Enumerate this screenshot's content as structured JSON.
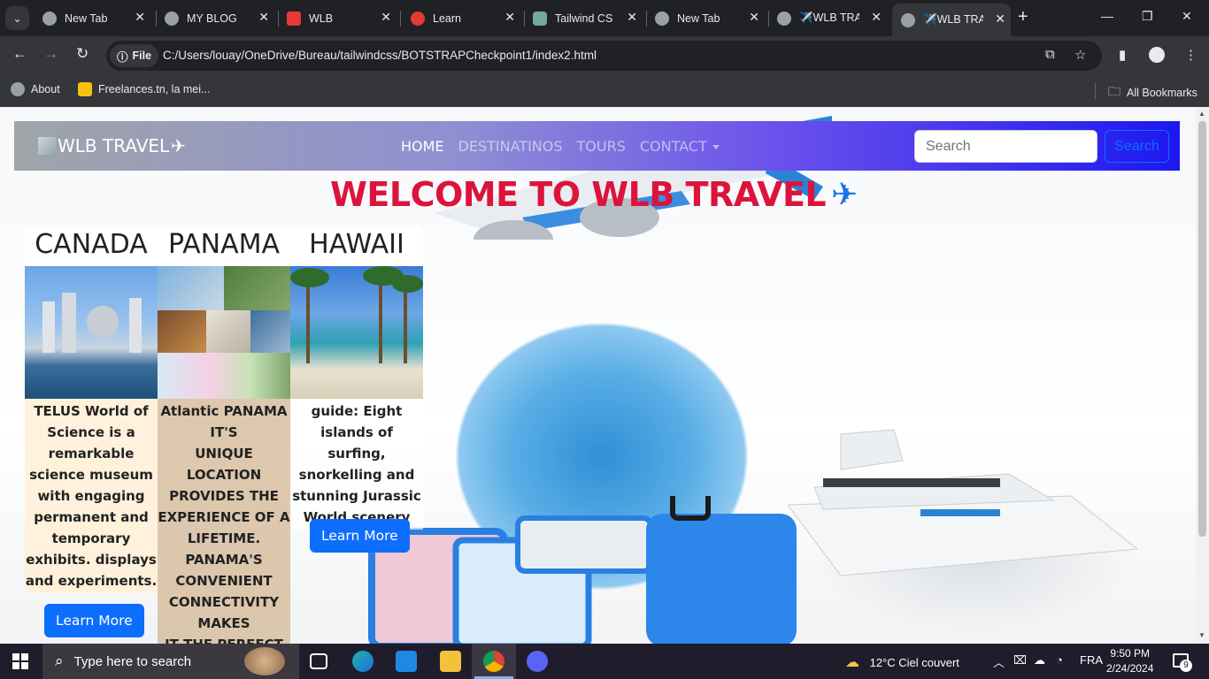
{
  "browser": {
    "tabs": [
      {
        "title": "New Tab",
        "favicon": "chrome-icon"
      },
      {
        "title": "MY BLOG",
        "favicon": "globe-icon"
      },
      {
        "title": "WLB",
        "favicon": "red-d-icon"
      },
      {
        "title": "Learn",
        "favicon": "red-circle-icon"
      },
      {
        "title": "Tailwind CSS",
        "favicon": "chatgpt-icon"
      },
      {
        "title": "New Tab",
        "favicon": "chrome-icon"
      },
      {
        "title": "✈️WLB TRAVEL",
        "favicon": "globe-icon"
      },
      {
        "title": "✈️WLB TRAVEL",
        "favicon": "globe-icon",
        "active": true
      }
    ],
    "address": {
      "scheme_label": "File",
      "url": "C:/Users/louay/OneDrive/Bureau/tailwindcss/BOTSTRAPCheckpoint1/index2.html"
    },
    "bookmarks": [
      {
        "label": "About"
      },
      {
        "label": "Freelances.tn, la mei..."
      }
    ],
    "all_bookmarks_label": "All Bookmarks"
  },
  "page": {
    "navbar": {
      "brand": "WLB TRAVEL",
      "links": [
        {
          "label": "HOME",
          "active": true
        },
        {
          "label": "DESTINATINOS"
        },
        {
          "label": "TOURS"
        },
        {
          "label": "CONTACT",
          "dropdown": true
        }
      ],
      "search_placeholder": "Search",
      "search_button": "Search"
    },
    "welcome": "WELCOME TO WLB TRAVEL",
    "cards": [
      {
        "title": "CANADA",
        "text": "TELUS World of Science is a remarkable science museum with engaging permanent and temporary exhibits. displays and experiments.",
        "button": "Learn More"
      },
      {
        "title": "PANAMA",
        "text": "Atlantic PANAMA IT'S\nUNIQUE LOCATION PROVIDES THE EXPERIENCE OF A LIFETIME.\nPANAMA'S CONVENIENT CONNECTIVITY MAKES\nIT THE PERFECT PLACE FOR"
      },
      {
        "title": "HAWAII",
        "text": "guide: Eight islands of surfing, snorkelling and stunning Jurassic World scenery",
        "button": "Learn More"
      }
    ],
    "colors": {
      "welcome": "#dc143c",
      "primary": "#0d6efd"
    }
  },
  "taskbar": {
    "search_placeholder": "Type here to search",
    "weather": "12°C  Ciel couvert",
    "language": "FRA",
    "time": "9:50 PM",
    "date": "2/24/2024",
    "notification_count": "9"
  }
}
